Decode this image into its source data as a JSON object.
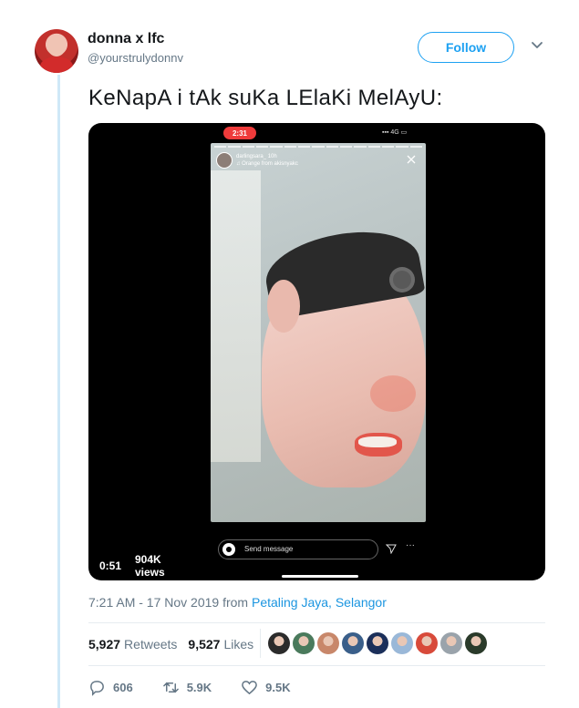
{
  "header": {
    "display_name": "donna x lfc",
    "handle": "@yourstrulydonnv",
    "follow_label": "Follow"
  },
  "tweet": {
    "text": "KeNapA i tAk suKa LElaKi MelAyU:"
  },
  "media": {
    "story_timer": "2:31",
    "status_right": "4G",
    "story_user": "darlingsara_",
    "story_age": "10h",
    "story_song": "Orange",
    "story_song_source": "from akisnyakc",
    "reply_placeholder": "Send message",
    "duration": "0:51",
    "views": "904K views"
  },
  "meta": {
    "timestamp": "7:21 AM - 17 Nov 2019 from",
    "location": "Petaling Jaya, Selangor"
  },
  "stats": {
    "retweets_count": "5,927",
    "retweets_label": "Retweets",
    "likes_count": "9,527",
    "likes_label": "Likes",
    "liker_colors": [
      "#2b2b2b",
      "#4a7a5c",
      "#c8876a",
      "#3a5f8a",
      "#1b2f5a",
      "#9ab8d8",
      "#d84a3a",
      "#9aa3ab",
      "#2a3a2a"
    ]
  },
  "actions": {
    "replies": "606",
    "retweets": "5.9K",
    "likes": "9.5K"
  },
  "colors": {
    "accent": "#1da1f2",
    "link": "#1b95e0",
    "muted": "#657786"
  }
}
